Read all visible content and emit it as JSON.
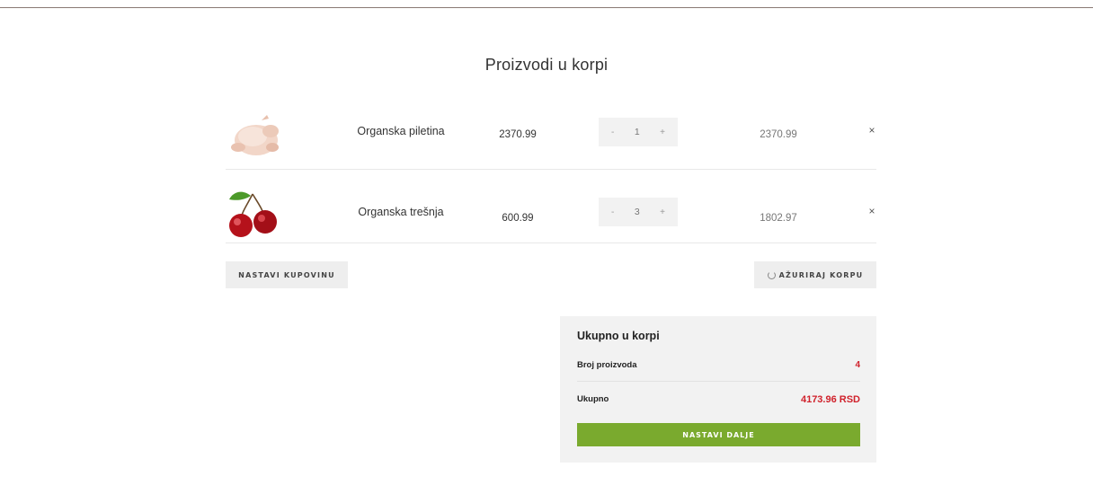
{
  "page": {
    "title": "Proizvodi u korpi"
  },
  "cart": {
    "items": [
      {
        "name": "Organska piletina",
        "price": "2370.99",
        "qty_minus": "-",
        "quantity": "1",
        "qty_plus": "+",
        "total": "2370.99",
        "remove": "×",
        "image_icon": "chicken-image"
      },
      {
        "name": "Organska trešnja",
        "price": "600.99",
        "qty_minus": "-",
        "quantity": "3",
        "qty_plus": "+",
        "total": "1802.97",
        "remove": "×",
        "image_icon": "cherry-image"
      }
    ]
  },
  "actions": {
    "continue_label": "NASTAVI KUPOVINU",
    "update_label": "AŽURIRAJ KORPU",
    "update_icon": "spinner-icon"
  },
  "totals": {
    "heading": "Ukupno u korpi",
    "count_label": "Broj proizvoda",
    "count_value": "4",
    "total_label": "Ukupno",
    "total_value": "4173.96 RSD",
    "checkout_label": "NASTAVI DALJE"
  },
  "colors": {
    "accent_green": "#7aaa2e",
    "price_red": "#d0212b",
    "panel_grey": "#f2f2f2"
  }
}
